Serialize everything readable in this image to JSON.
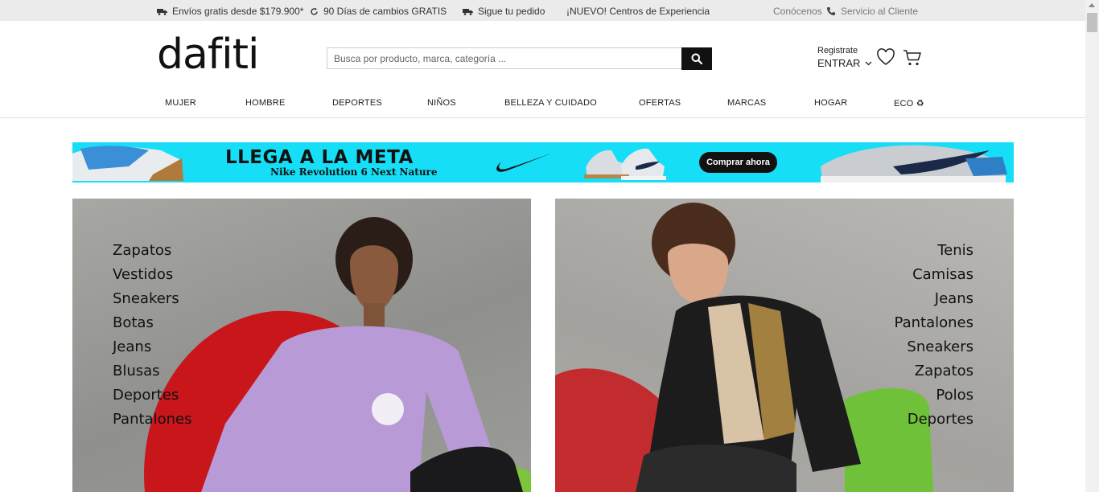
{
  "topbar": {
    "shipping": "Envíos gratis desde $179.900*",
    "returns": "90 Días de cambios GRATIS",
    "tracking": "Sigue tu pedido",
    "centers": "¡NUEVO! Centros de Experiencia",
    "about": "Conócenos",
    "service": "Servicio al Cliente"
  },
  "header": {
    "logo": "dafiti",
    "search_placeholder": "Busca por producto, marca, categoría ...",
    "register": "Registrate",
    "enter": "ENTRAR"
  },
  "nav": {
    "items": [
      "MUJER",
      "HOMBRE",
      "DEPORTES",
      "NIÑOS",
      "BELLEZA Y CUIDADO",
      "OFERTAS",
      "MARCAS",
      "HOGAR",
      "ECO ♻"
    ]
  },
  "banner": {
    "title": "LLEGA A LA META",
    "subtitle": "Nike Revolution 6 Next Nature",
    "cta": "Comprar ahora"
  },
  "women": {
    "categories": [
      "Zapatos",
      "Vestidos",
      "Sneakers",
      "Botas",
      "Jeans",
      "Blusas",
      "Deportes",
      "Pantalones"
    ]
  },
  "men": {
    "categories": [
      "Tenis",
      "Camisas",
      "Jeans",
      "Pantalones",
      "Sneakers",
      "Zapatos",
      "Polos",
      "Deportes"
    ]
  },
  "colors": {
    "banner_bg": "#16def7",
    "topbar_bg": "#ebebeb",
    "search_button": "#111111"
  }
}
